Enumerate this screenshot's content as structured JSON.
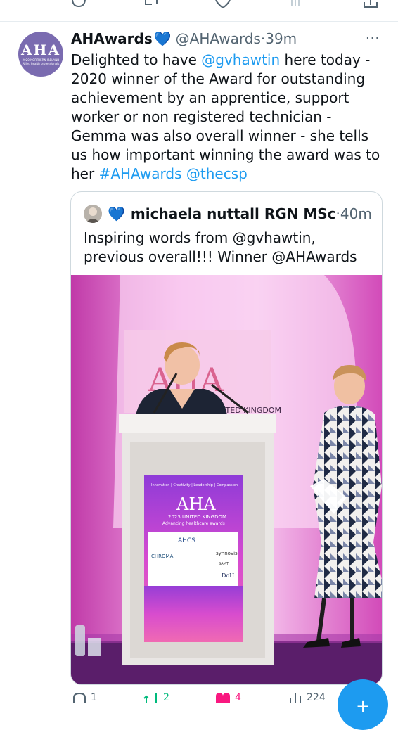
{
  "prev_tweet_actions": {
    "icons": [
      "reply-icon",
      "retweet-icon",
      "like-icon",
      "views-icon",
      "share-icon"
    ]
  },
  "tweet": {
    "display_name": "AHAwards",
    "verified_emoji": "💙",
    "handle": "@AHAwards",
    "separator": "·",
    "time": "39m",
    "more_label": "···",
    "avatar_logo_text": "AHA",
    "avatar_sub_text": "2020 NORTHERN IRELAND Allied health professionals",
    "text": {
      "part1": "Delighted to have ",
      "mention1": "@gvhawtin",
      "part2": " here today - 2020 winner of the Award for outstanding achievement by an apprentice, support worker or non registered technician - Gemma was also overall winner - she tells us how important winning the award was to her ",
      "hashtag": "#AHAwards",
      "space": " ",
      "mention2": "@thecsp"
    }
  },
  "quoted": {
    "heart": "💙",
    "display_name": "michaela nuttall RGN MSc",
    "separator": "·",
    "time": "40m",
    "text": "Inspiring words from @gvhawtin, previous overall!!! Winner @AHAwards",
    "photo": {
      "backdrop_logo": "AHA",
      "backdrop_sub": "UNITED KINGDOM",
      "screen_tagline": "Innovation | Creativity | Leadership | Compassion",
      "screen_logo": "AHA",
      "screen_title": "2023 UNITED KINGDOM",
      "screen_subtitle": "Advancing healthcare awards",
      "sponsors": [
        "AHCS",
        "CHROMA",
        "synnovis",
        "SAMT",
        "DoH"
      ]
    }
  },
  "actions": {
    "reply_count": "1",
    "retweet_count": "2",
    "like_count": "4",
    "views_count": "224"
  },
  "colors": {
    "link": "#1d9bf0",
    "secondary_text": "#536471",
    "retweet_green": "#00ba7c",
    "like_pink": "#f91880",
    "avatar_purple": "#7a6bb0"
  }
}
